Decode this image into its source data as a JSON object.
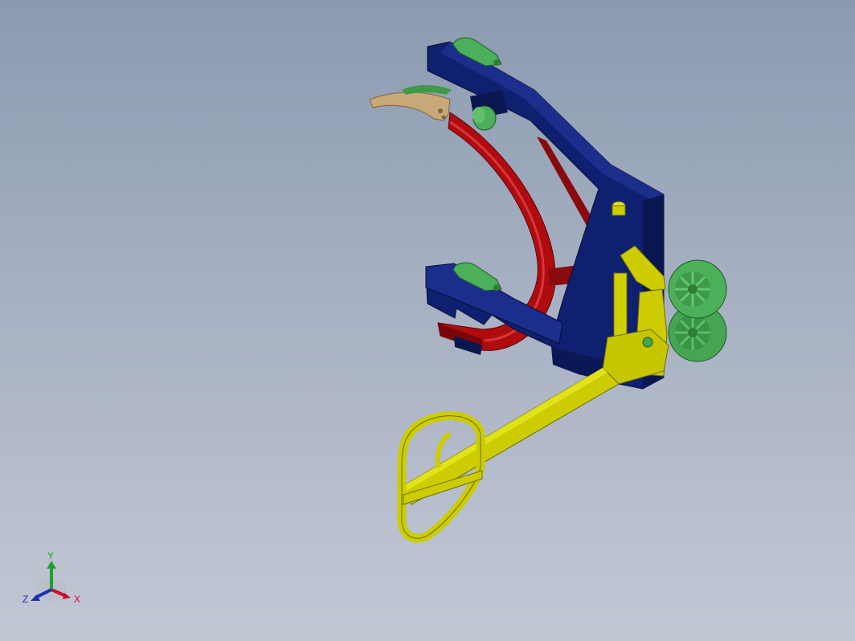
{
  "viewport": {
    "background_top": "#8b9ab0",
    "background_bottom": "#c2c7d4"
  },
  "model": {
    "parts": [
      {
        "name": "frame",
        "color": "#102070"
      },
      {
        "name": "arc-clamp",
        "color": "#b00c10"
      },
      {
        "name": "handle",
        "color": "#cccc00"
      },
      {
        "name": "wheels",
        "color": "#4caf5a"
      },
      {
        "name": "clamp-pads",
        "color": "#48a84e"
      },
      {
        "name": "tan-jaw",
        "color": "#c9a878"
      }
    ]
  },
  "triad": {
    "x_label": "X",
    "y_label": "Y",
    "z_label": "Z",
    "x_color": "#c8102e",
    "y_color": "#1e9e2e",
    "z_color": "#1a2fb0"
  }
}
